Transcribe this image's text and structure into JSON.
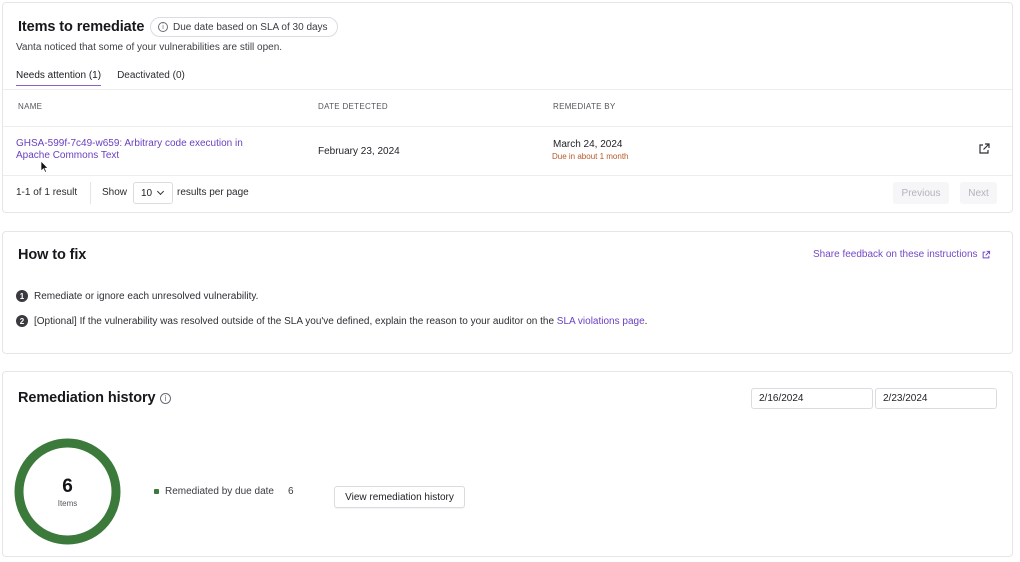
{
  "items_card": {
    "title": "Items to remediate",
    "sla_pill": "Due date based on SLA of 30 days",
    "subtitle": "Vanta noticed that some of your vulnerabilities are still open.",
    "tabs": [
      {
        "label": "Needs attention (1)",
        "active": true
      },
      {
        "label": "Deactivated (0)",
        "active": false
      }
    ],
    "columns": [
      "NAME",
      "DATE DETECTED",
      "REMEDIATE BY"
    ],
    "rows": [
      {
        "name": "GHSA-599f-7c49-w659: Arbitrary code execution in Apache Commons Text",
        "date_detected": "February 23, 2024",
        "remediate_by": "March 24, 2024",
        "due_note": "Due in about 1 month",
        "action_icon": "external-link-icon"
      }
    ],
    "pagination": {
      "count_text": "1-1 of 1 result",
      "show_label": "Show",
      "per_page": "10",
      "per_page_suffix": "results per page",
      "previous_label": "Previous",
      "next_label": "Next"
    }
  },
  "how_to_fix": {
    "title": "How to fix",
    "feedback_link": "Share feedback on these instructions",
    "steps": [
      {
        "num": "1",
        "text": "Remediate or ignore each unresolved vulnerability."
      },
      {
        "num": "2",
        "text_before": "[Optional] If the vulnerability was resolved outside of the SLA you've defined, explain the reason to your auditor on the ",
        "link": "SLA violations page",
        "text_after": "."
      }
    ]
  },
  "remediation_history": {
    "title": "Remediation history",
    "date_from": "2/16/2024",
    "date_to": "2/23/2024",
    "total": "6",
    "total_label": "Items",
    "legend": [
      {
        "label": "Remediated by due date",
        "value": "6",
        "color": "#3b7a3b"
      }
    ],
    "view_button": "View remediation history"
  },
  "colors": {
    "accent": "#7448c6",
    "link": "#6a3fbf",
    "due_warning": "#b5582a",
    "donut_green": "#3b7a3b"
  }
}
